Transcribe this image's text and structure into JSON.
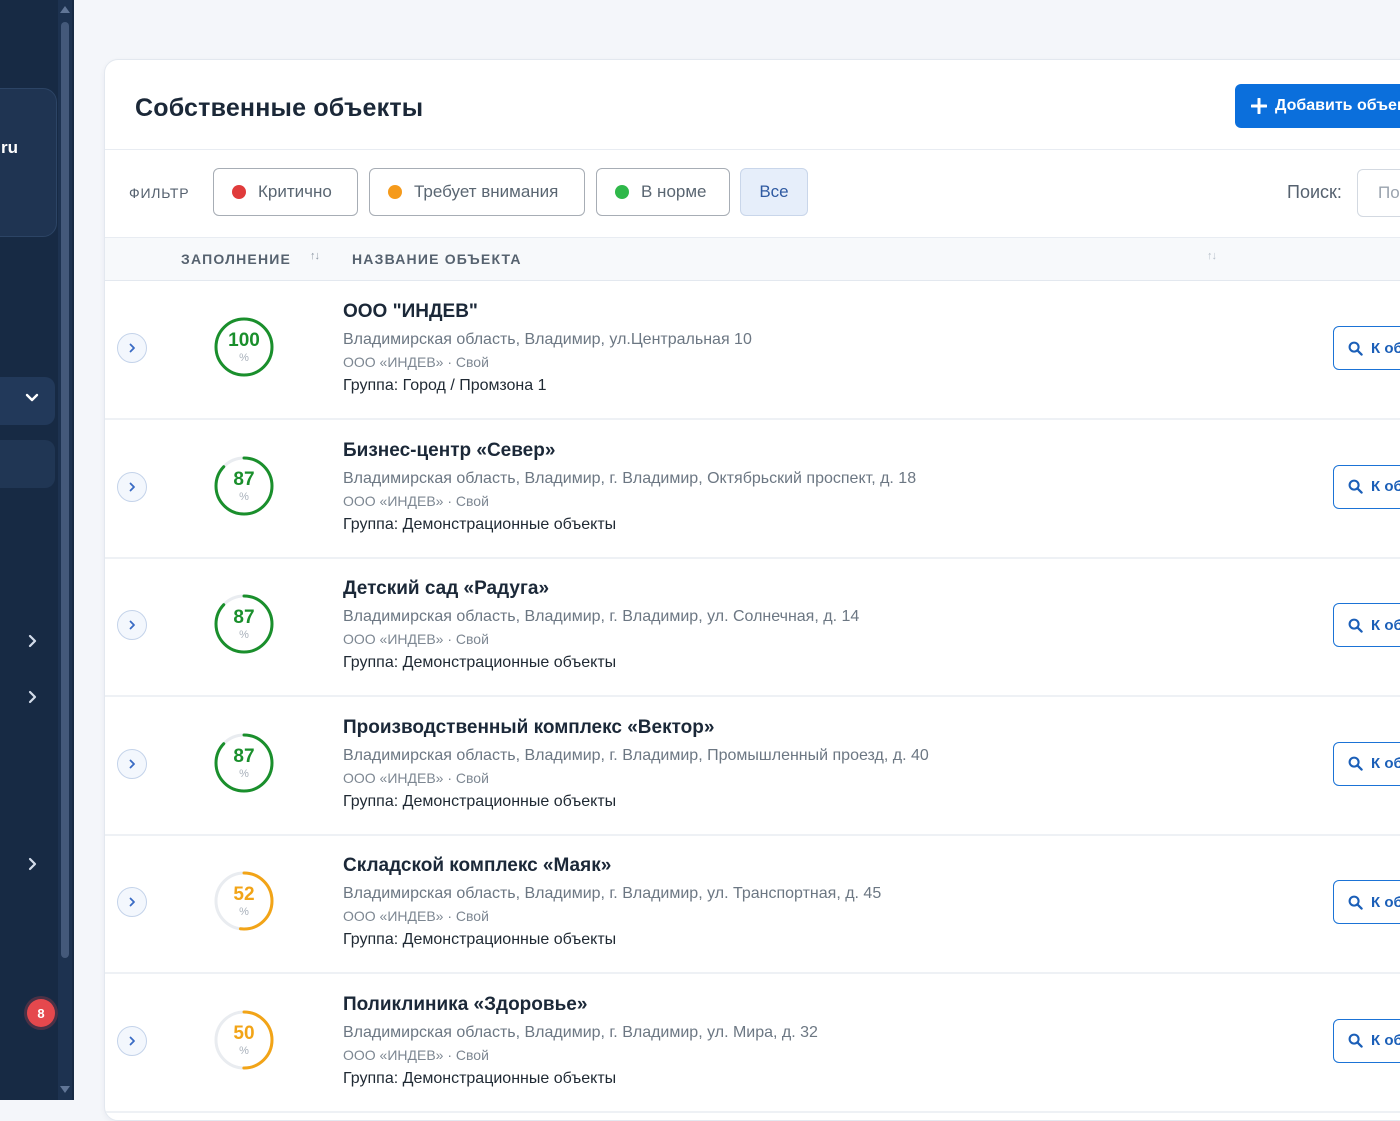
{
  "sidebar": {
    "card_text": "ru",
    "badge_count": "8",
    "chevron_down": "⌄",
    "chevron_right": "›"
  },
  "header": {
    "title": "Собственные объекты",
    "add_button_label": "Добавить объект",
    "add_button_icon": "plus-icon"
  },
  "filter": {
    "label": "ФИЛЬТР",
    "options": [
      {
        "label": "Критично",
        "color": "#e03b3b"
      },
      {
        "label": "Требует внимания",
        "color": "#f59a1b"
      },
      {
        "label": "В норме",
        "color": "#2fb84a"
      },
      {
        "label": "Все",
        "active": true
      }
    ]
  },
  "search": {
    "label": "Поиск:",
    "placeholder": "Поиск",
    "value": ""
  },
  "table": {
    "columns": [
      {
        "label": "ЗАПОЛНЕНИЕ",
        "sortable": true
      },
      {
        "label": "НАЗВАНИЕ ОБЪЕКТА",
        "sortable": true
      }
    ],
    "sort_icon": "⇅",
    "goto_label": "К объекту",
    "percent_unit": "%",
    "rows": [
      {
        "fill": 100,
        "name": "ООО \"ИНДЕВ\"",
        "address": "Владимирская область, Владимир, ул.Центральная 10",
        "org": "ООО «ИНДЕВ» · Свой",
        "group": "Группа: Город / Промзона 1"
      },
      {
        "fill": 87,
        "name": "Бизнес-центр «Север»",
        "address": "Владимирская область, Владимир, г. Владимир, Октябрьский проспект, д. 18",
        "org": "ООО «ИНДЕВ» · Свой",
        "group": "Группа: Демонстрационные объекты"
      },
      {
        "fill": 87,
        "name": "Детский сад «Радуга»",
        "address": "Владимирская область, Владимир, г. Владимир, ул. Солнечная, д. 14",
        "org": "ООО «ИНДЕВ» · Свой",
        "group": "Группа: Демонстрационные объекты"
      },
      {
        "fill": 87,
        "name": "Производственный комплекс «Вектор»",
        "address": "Владимирская область, Владимир, г. Владимир, Промышленный проезд, д. 40",
        "org": "ООО «ИНДЕВ» · Свой",
        "group": "Группа: Демонстрационные объекты"
      },
      {
        "fill": 52,
        "name": "Складской комплекс «Маяк»",
        "address": "Владимирская область, Владимир, г. Владимир, ул. Транспортная, д. 45",
        "org": "ООО «ИНДЕВ» · Свой",
        "group": "Группа: Демонстрационные объекты"
      },
      {
        "fill": 50,
        "name": "Поликлиника «Здоровье»",
        "address": "Владимирская область, Владимир, г. Владимир, ул. Мира, д. 32",
        "org": "ООО «ИНДЕВ» · Свой",
        "group": "Группа: Демонстрационные объекты"
      }
    ]
  },
  "colors": {
    "good": "#1a8f2c",
    "warn": "#f2a417",
    "track": "#e9ecf0",
    "accent": "#0b6fdc"
  }
}
